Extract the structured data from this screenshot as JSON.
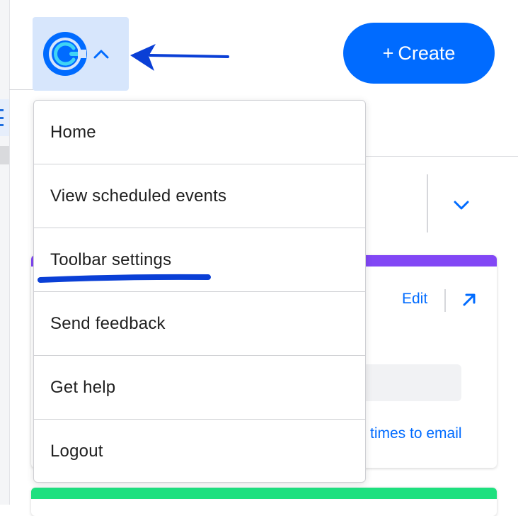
{
  "header": {
    "create_button": {
      "plus": "+",
      "label": "Create"
    },
    "logo_icon": "calendly-logo-icon",
    "logo_chevron_icon": "chevron-up-icon"
  },
  "menu": {
    "items": [
      {
        "label": "Home"
      },
      {
        "label": "View scheduled events"
      },
      {
        "label": "Toolbar settings"
      },
      {
        "label": "Send feedback"
      },
      {
        "label": "Get help"
      },
      {
        "label": "Logout"
      }
    ]
  },
  "background": {
    "card": {
      "edit_label": "Edit",
      "times_to_email_label": "times to email",
      "accent_color": "#8247f5"
    },
    "card2_accent_color": "#1ee07f"
  },
  "colors": {
    "brand_blue": "#006bff",
    "logo_highlight_bg": "#d7e6fc",
    "annotation_blue": "#0a3fd6"
  }
}
